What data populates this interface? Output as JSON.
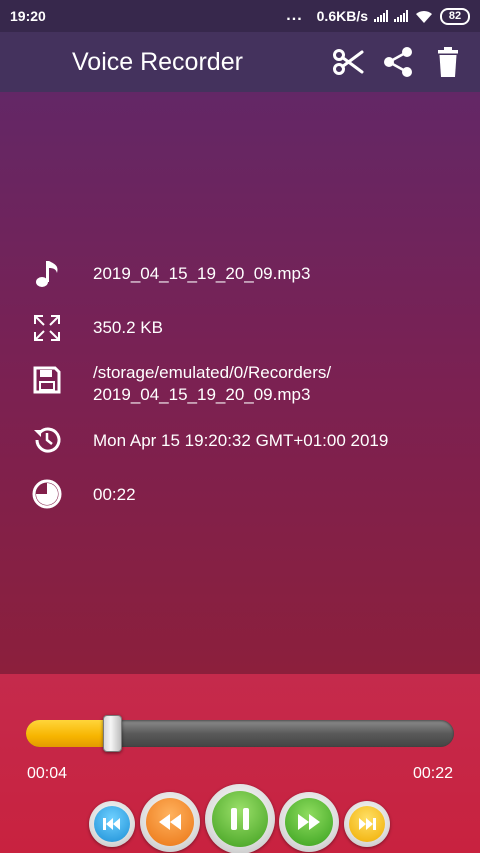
{
  "status_bar": {
    "time": "19:20",
    "dots": "...",
    "net_speed": "0.6KB/s",
    "battery": "82"
  },
  "toolbar": {
    "title": "Voice Recorder",
    "actions": [
      {
        "icon": "scissors-icon"
      },
      {
        "icon": "share-icon"
      },
      {
        "icon": "trash-icon"
      }
    ]
  },
  "info": {
    "file_name": "2019_04_15_19_20_09.mp3",
    "file_size": "350.2 KB",
    "path_line1": "/storage/emulated/0/Recorders/",
    "path_line2": "2019_04_15_19_20_09.mp3",
    "date": "Mon Apr 15 19:20:32 GMT+01:00 2019",
    "duration": "00:22"
  },
  "player": {
    "current_time": "00:04",
    "total_time": "00:22",
    "progress_fraction": 0.2
  },
  "colors": {
    "accent_yellow": "#f7b500",
    "btn_blue": "#2aa7e6",
    "btn_orange": "#f58a1f",
    "btn_green": "#4caf2a",
    "btn_yellow": "#f5c21b"
  }
}
